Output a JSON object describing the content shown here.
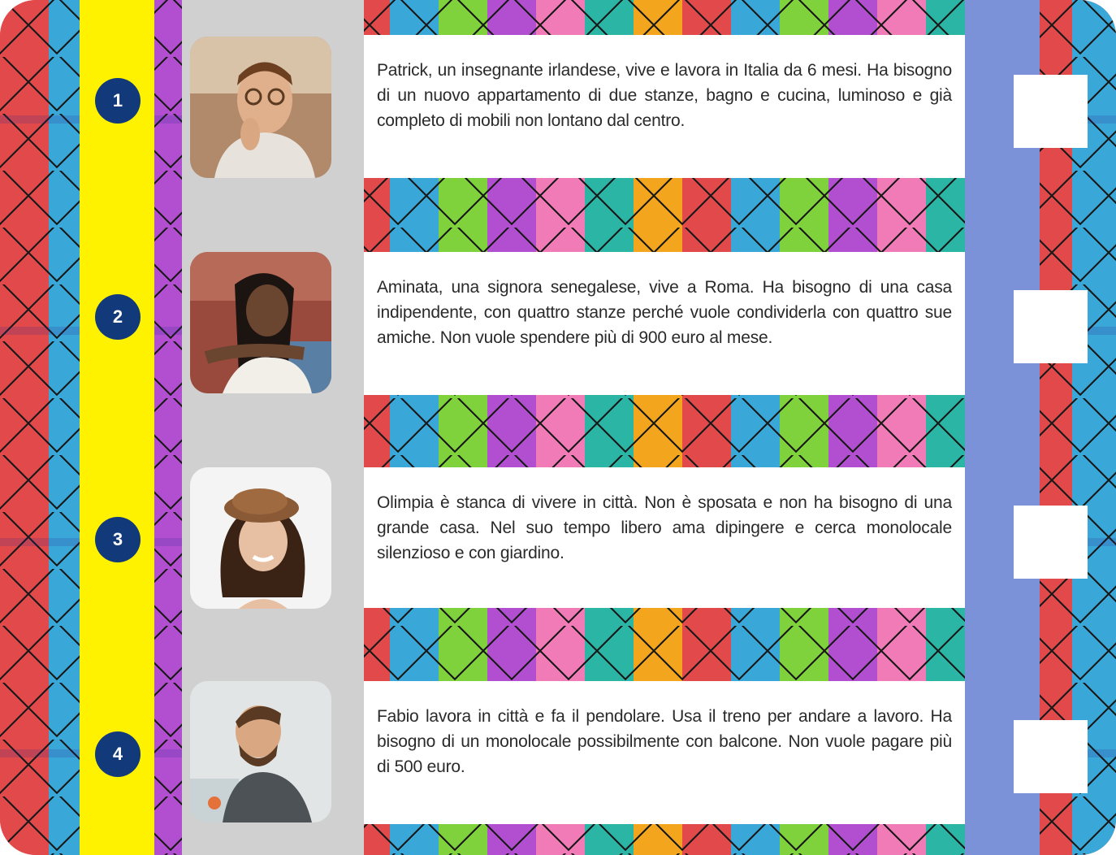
{
  "items": [
    {
      "number": "1",
      "photo_icon": "portrait-man-glasses",
      "text": "Patrick, un insegnante irlandese, vive e lavora in Italia da 6 mesi. Ha bisogno di un nuovo appartamento di due stanze, bagno e cucina, luminoso e già completo di mobili non lontano dal centro."
    },
    {
      "number": "2",
      "photo_icon": "portrait-woman-smiling",
      "text": "Aminata, una signora senegalese, vive a Roma. Ha bisogno di una casa indipendente, con quattro stanze perché vuole condividerla con quattro sue amiche. Non vuole spendere più di 900 euro al mese."
    },
    {
      "number": "3",
      "photo_icon": "portrait-woman-hat",
      "text": "Olimpia è stanca di vivere in città. Non è sposata e non ha bisogno di una grande casa. Nel suo tempo libero ama dipingere e cerca monolocale silenzioso e con giardino."
    },
    {
      "number": "4",
      "photo_icon": "portrait-man-beard",
      "text": "Fabio lavora in città e fa il pendolare. Usa il treno per andare a lavoro. Ha bisogno di un monolocale possibilmente con balcone. Non vuole pagare più di 500 euro."
    }
  ],
  "colors": {
    "badge": "#123a7a",
    "yellow_strip": "#fff200",
    "blue_strip": "#7b91d8",
    "grey_column": "#d0d0d0"
  }
}
